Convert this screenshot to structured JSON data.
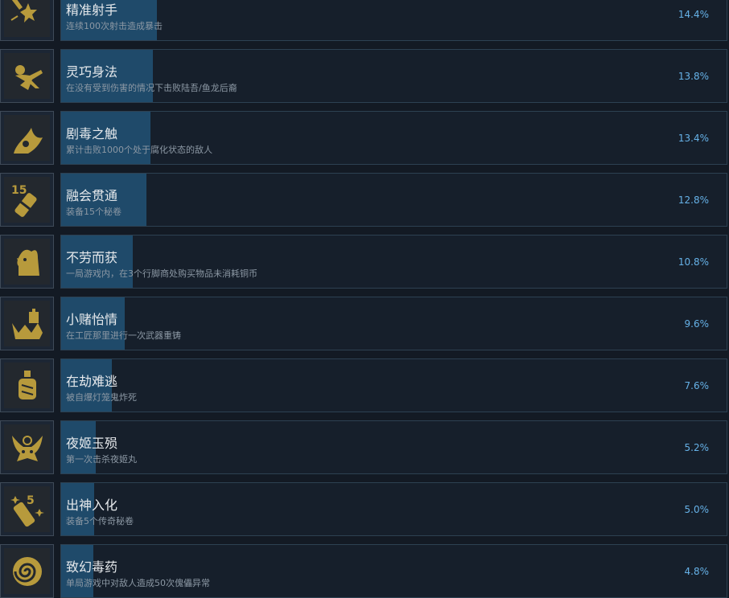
{
  "colors": {
    "background": "#131a24",
    "panel": "#161f2b",
    "panel_border": "#2d4152",
    "progress_fill": "#1f4a6a",
    "icon_gold": "#b79a3c",
    "title_text": "#e6e9ec",
    "desc_text": "#8c98a4",
    "percent_text": "#66b2e8"
  },
  "achievements": [
    {
      "icon": "burst-shot-icon",
      "title": "精准射手",
      "desc": "连续100次射击造成暴击",
      "percent": "14.4%",
      "unlock_rate": 14.4
    },
    {
      "icon": "dodging-figure-icon",
      "title": "灵巧身法",
      "desc": "在没有受到伤害的情况下击败陆吾/鱼龙后裔",
      "percent": "13.8%",
      "unlock_rate": 13.8
    },
    {
      "icon": "venom-claw-icon",
      "title": "剧毒之触",
      "desc": "累计击败1000个处于腐化状态的敌人",
      "percent": "13.4%",
      "unlock_rate": 13.4
    },
    {
      "icon": "scroll-15-icon",
      "title": "融会贯通",
      "desc": "装备15个秘卷",
      "percent": "12.8%",
      "unlock_rate": 12.8
    },
    {
      "icon": "rooster-icon",
      "title": "不劳而获",
      "desc": "一局游戏内，在3个行脚商处购买物品未消耗铜币",
      "percent": "10.8%",
      "unlock_rate": 10.8
    },
    {
      "icon": "anvil-crown-icon",
      "title": "小赌怡情",
      "desc": "在工匠那里进行一次武器重铸",
      "percent": "9.6%",
      "unlock_rate": 9.6
    },
    {
      "icon": "lantern-icon",
      "title": "在劫难逃",
      "desc": "被自爆灯笼鬼炸死",
      "percent": "7.6%",
      "unlock_rate": 7.6
    },
    {
      "icon": "demon-mask-icon",
      "title": "夜姬玉殒",
      "desc": "第一次击杀夜姬丸",
      "percent": "5.2%",
      "unlock_rate": 5.2
    },
    {
      "icon": "scroll-5-icon",
      "title": "出神入化",
      "desc": "装备5个传奇秘卷",
      "percent": "5.0%",
      "unlock_rate": 5.0
    },
    {
      "icon": "spiral-icon",
      "title": "致幻毒药",
      "desc": "单局游戏中对敌人造成50次傀儡异常",
      "percent": "4.8%",
      "unlock_rate": 4.8
    }
  ]
}
